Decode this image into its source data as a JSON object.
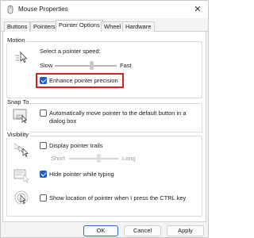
{
  "window": {
    "title": "Mouse Properties",
    "close_glyph": "✕"
  },
  "tabs": [
    {
      "label": "Buttons",
      "active": false
    },
    {
      "label": "Pointers",
      "active": false
    },
    {
      "label": "Pointer Options",
      "active": true
    },
    {
      "label": "Wheel",
      "active": false
    },
    {
      "label": "Hardware",
      "active": false
    }
  ],
  "motion": {
    "group_label": "Motion",
    "prompt": "Select a pointer speed:",
    "slow_label": "Slow",
    "fast_label": "Fast",
    "speed_level": 0.6,
    "precision_label": "Enhance pointer precision",
    "precision_checked": true
  },
  "snap_to": {
    "group_label": "Snap To",
    "line1": "Automatically move pointer to the default button in a",
    "line2": "dialog box",
    "checked": false
  },
  "visibility": {
    "group_label": "Visibility",
    "trails_label": "Display pointer trails",
    "trails_checked": false,
    "short_label": "Short",
    "long_label": "Long",
    "trail_level": 0.6,
    "hide_label": "Hide pointer while typing",
    "hide_checked": true,
    "ctrl_label": "Show location of pointer when I press the CTRL key",
    "ctrl_checked": false
  },
  "footer": {
    "ok_label": "OK",
    "cancel_label": "Cancel",
    "apply_label": "Apply"
  },
  "colors": {
    "accent": "#1f5fb8",
    "highlight": "#d4201f"
  }
}
